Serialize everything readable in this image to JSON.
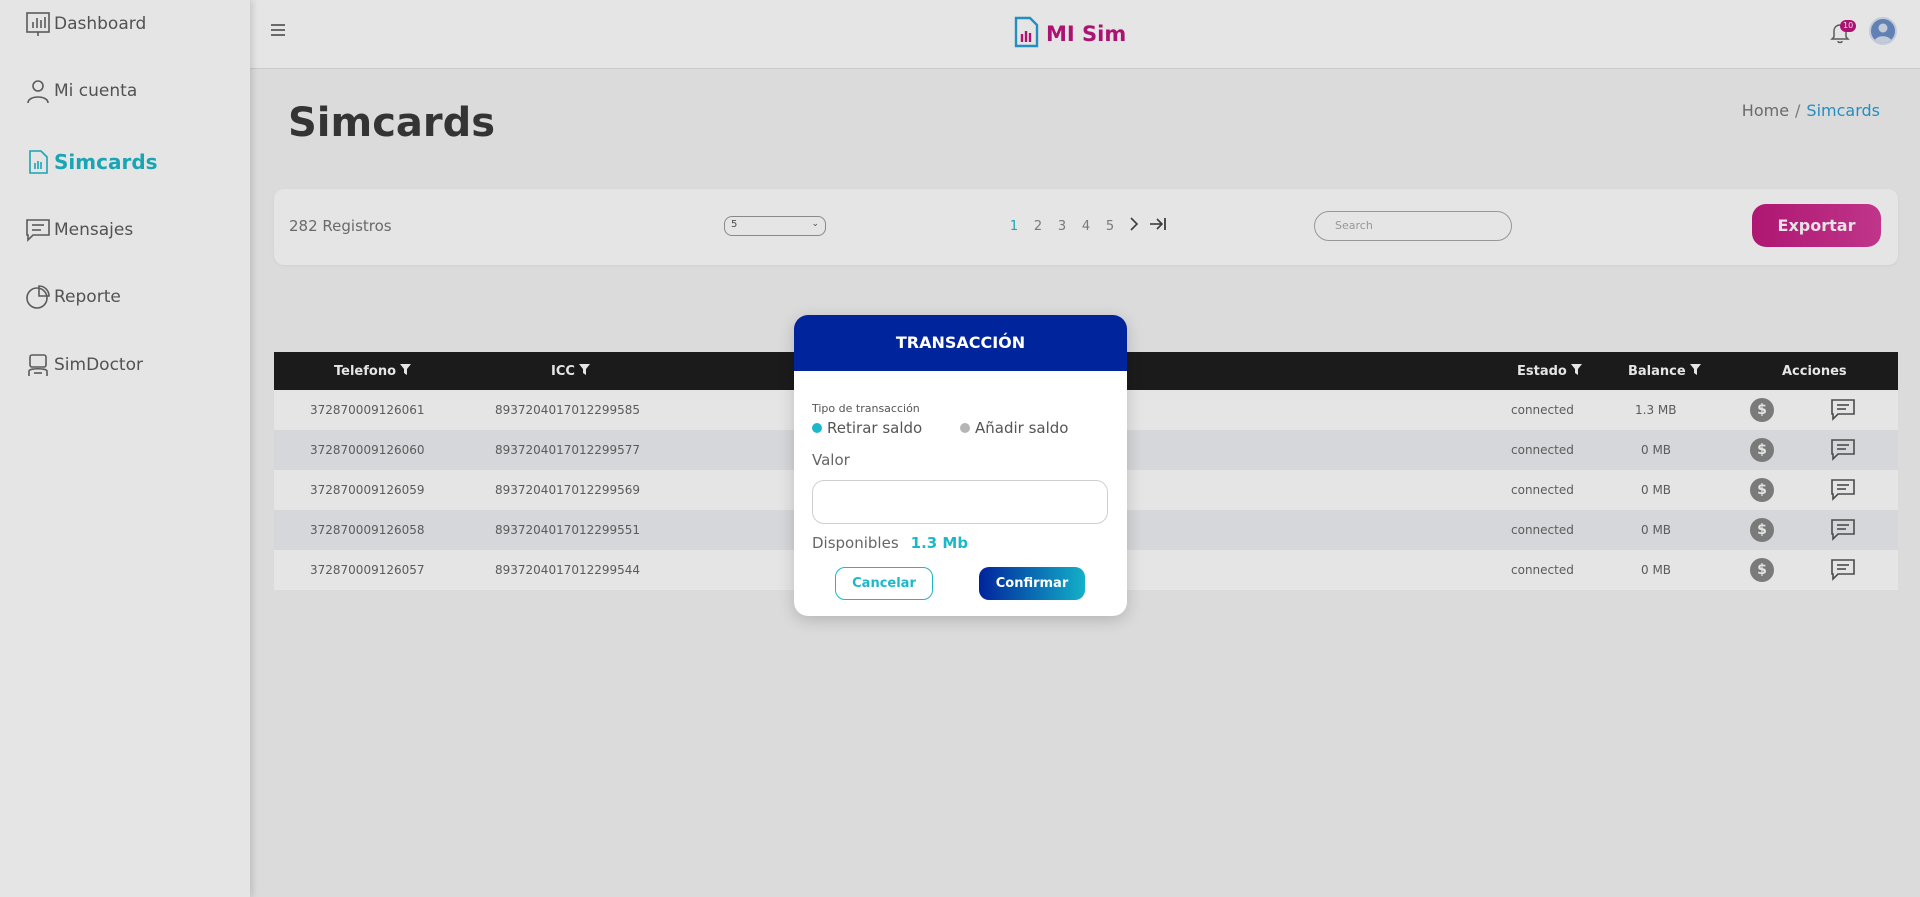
{
  "app": {
    "name": "MI Sim"
  },
  "sidebar": {
    "items": [
      {
        "label": "Dashboard",
        "icon": "chart-icon"
      },
      {
        "label": "Mi cuenta",
        "icon": "user-icon"
      },
      {
        "label": "Simcards",
        "icon": "sim-icon",
        "active": true
      },
      {
        "label": "Mensajes",
        "icon": "message-icon"
      },
      {
        "label": "Reporte",
        "icon": "pie-chart-icon"
      },
      {
        "label": "SimDoctor",
        "icon": "doctor-icon"
      }
    ]
  },
  "header": {
    "notifications_count": "10"
  },
  "page": {
    "title": "Simcards",
    "breadcrumb": {
      "home": "Home",
      "separator": "/",
      "current": "Simcards"
    }
  },
  "toolbar": {
    "records": "282 Registros",
    "page_size": "5",
    "pages": [
      "1",
      "2",
      "3",
      "4",
      "5"
    ],
    "search_placeholder": "Search",
    "export_label": "Exportar"
  },
  "table": {
    "headers": {
      "telefono": "Telefono",
      "icc": "ICC",
      "estado": "Estado",
      "balance": "Balance",
      "acciones": "Acciones"
    },
    "rows": [
      {
        "telefono": "372870009126061",
        "icc": "8937204017012299585",
        "estado": "connected",
        "balance": "1.3 MB"
      },
      {
        "telefono": "372870009126060",
        "icc": "8937204017012299577",
        "estado": "connected",
        "balance": "0 MB"
      },
      {
        "telefono": "372870009126059",
        "icc": "8937204017012299569",
        "estado": "connected",
        "balance": "0 MB"
      },
      {
        "telefono": "372870009126058",
        "icc": "8937204017012299551",
        "estado": "connected",
        "balance": "0 MB"
      },
      {
        "telefono": "372870009126057",
        "icc": "8937204017012299544",
        "estado": "connected",
        "balance": "0 MB"
      }
    ]
  },
  "modal": {
    "title": "TRANSACCIÓN",
    "type_label": "Tipo de transacción",
    "option_withdraw": "Retirar saldo",
    "option_add": "Añadir saldo",
    "value_label": "Valor",
    "value": "",
    "available_label": "Disponibles",
    "available_amount": "1.3 Mb",
    "cancel_label": "Cancelar",
    "confirm_label": "Confirmar"
  },
  "colors": {
    "brand": "#c0157e",
    "accent": "#1cb8c9",
    "modal_header": "#00249c"
  }
}
